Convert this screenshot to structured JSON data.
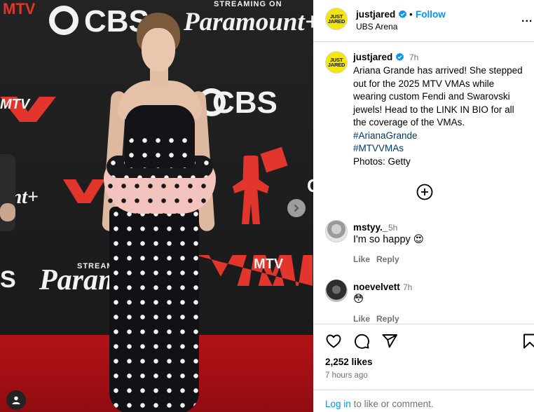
{
  "post": {
    "account": "justjared",
    "account_avatar_text": "JUST JARED",
    "follow_label": "Follow",
    "separator": "•",
    "location": "UBS Arena",
    "more_label": "..."
  },
  "caption": {
    "user": "justjared",
    "time": "7h",
    "text": "Ariana Grande has arrived! She stepped out for the 2025 MTV VMAs while wearing custom Fendi and Swarovski jewels! Head to the LINK IN BIO for all the coverage of the VMAs.",
    "hashtags": [
      "#ArianaGrande",
      "#MTVVMAs"
    ],
    "credit": "Photos: Getty"
  },
  "comments": [
    {
      "user": "mstyy._",
      "time": "5h",
      "text": "I'm so happy 😍",
      "like_label": "Like",
      "reply_label": "Reply"
    },
    {
      "user": "noevelvett",
      "time": "7h",
      "text": "😳",
      "like_label": "Like",
      "reply_label": "Reply"
    }
  ],
  "stats": {
    "likes": "2,252 likes",
    "time_ago": "7 hours ago"
  },
  "login": {
    "link": "Log in",
    "rest": "to like or comment."
  },
  "photo": {
    "backdrop_text": {
      "streaming": "STREAMING ON",
      "paramount": "Paramount+",
      "cbs": "CBS",
      "mtv": "MTV",
      "plus": "+",
      "stream": "STREAM",
      "paramount_partial": "Paramo",
      "on": "ON",
      "unt": "unt+"
    }
  },
  "colors": {
    "link_blue": "#0095f6",
    "hashtag": "#00376b",
    "verified": "#0095f6",
    "muted": "#737373",
    "avatar_yellow": "#f2e60c",
    "carpet_red": "#a30f14",
    "vma_red": "#e2352b"
  },
  "icons": [
    "heart-icon",
    "comment-icon",
    "share-icon",
    "bookmark-icon",
    "plus-circle-icon",
    "chevron-right-icon",
    "user-tag-icon",
    "verified-icon",
    "more-icon"
  ]
}
